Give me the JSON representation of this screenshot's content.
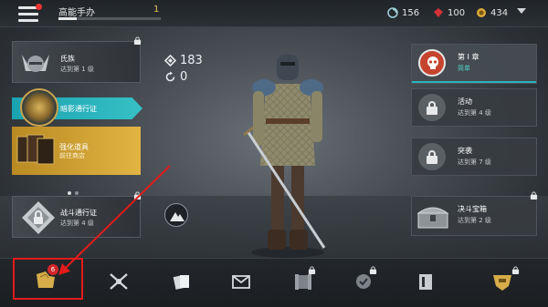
{
  "topbar": {
    "player_name": "高能手办",
    "player_level": "1",
    "xp_progress": 0.18,
    "currencies": [
      {
        "icon": "steel-icon",
        "value": "156"
      },
      {
        "icon": "ruby-icon",
        "value": "100"
      },
      {
        "icon": "coin-icon",
        "value": "434"
      }
    ]
  },
  "left": {
    "clan": {
      "title": "氏族",
      "sub": "达到第 1 级"
    },
    "shadow_pass": {
      "title": "暗影通行证"
    },
    "promo": {
      "title": "强化道具",
      "sub": "前往商店"
    },
    "battle_pass": {
      "title": "战斗通行证",
      "sub": "达到第 4 级"
    }
  },
  "stats": {
    "power": "183",
    "rerolls": "0"
  },
  "right": {
    "chapter": {
      "title": "第 I 章",
      "sub": "简单"
    },
    "events": {
      "title": "活动",
      "sub": "达到第 4 级"
    },
    "raid": {
      "title": "突袭",
      "sub": "达到第 7 级"
    },
    "chest": {
      "title": "决斗宝箱",
      "sub": "达到第 2 级"
    }
  },
  "bottom": {
    "inventory_badge": "6"
  },
  "colors": {
    "accent_teal": "#2ab4bb",
    "gold": "#e2b443",
    "highlight_red": "#e21b1b"
  }
}
